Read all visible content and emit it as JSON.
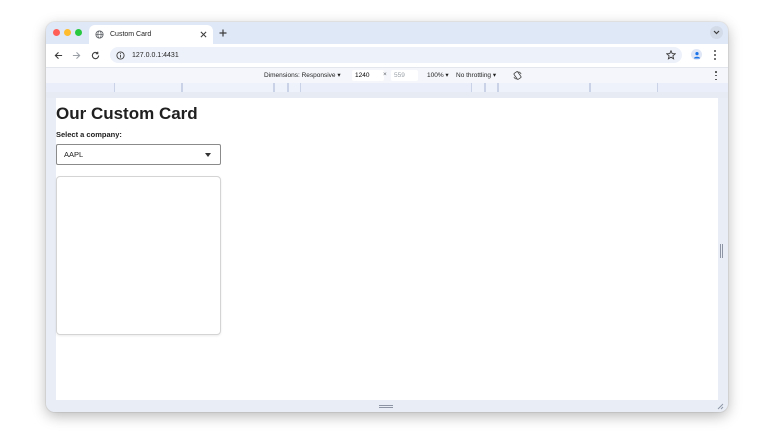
{
  "browser": {
    "tab_title": "Custom Card",
    "url": "127.0.0.1:4431"
  },
  "devtools": {
    "dimensions_label": "Dimensions: Responsive",
    "width_value": "1240",
    "times": "×",
    "height_value": "559",
    "zoom_label": "100%",
    "throttling_label": "No throttling"
  },
  "page": {
    "title": "Our Custom Card",
    "select_label": "Select a company:",
    "selected_company": "AAPL"
  },
  "icons": {
    "favicon": "globe-icon",
    "back": "back-arrow-icon",
    "forward": "forward-arrow-icon",
    "reload": "reload-icon",
    "site_info": "info-icon",
    "bookmark": "star-icon",
    "profile": "profile-icon",
    "rotate": "rotate-icon"
  },
  "colors": {
    "window_chrome": "#dfe8f7",
    "accent": "#1a73e8"
  }
}
